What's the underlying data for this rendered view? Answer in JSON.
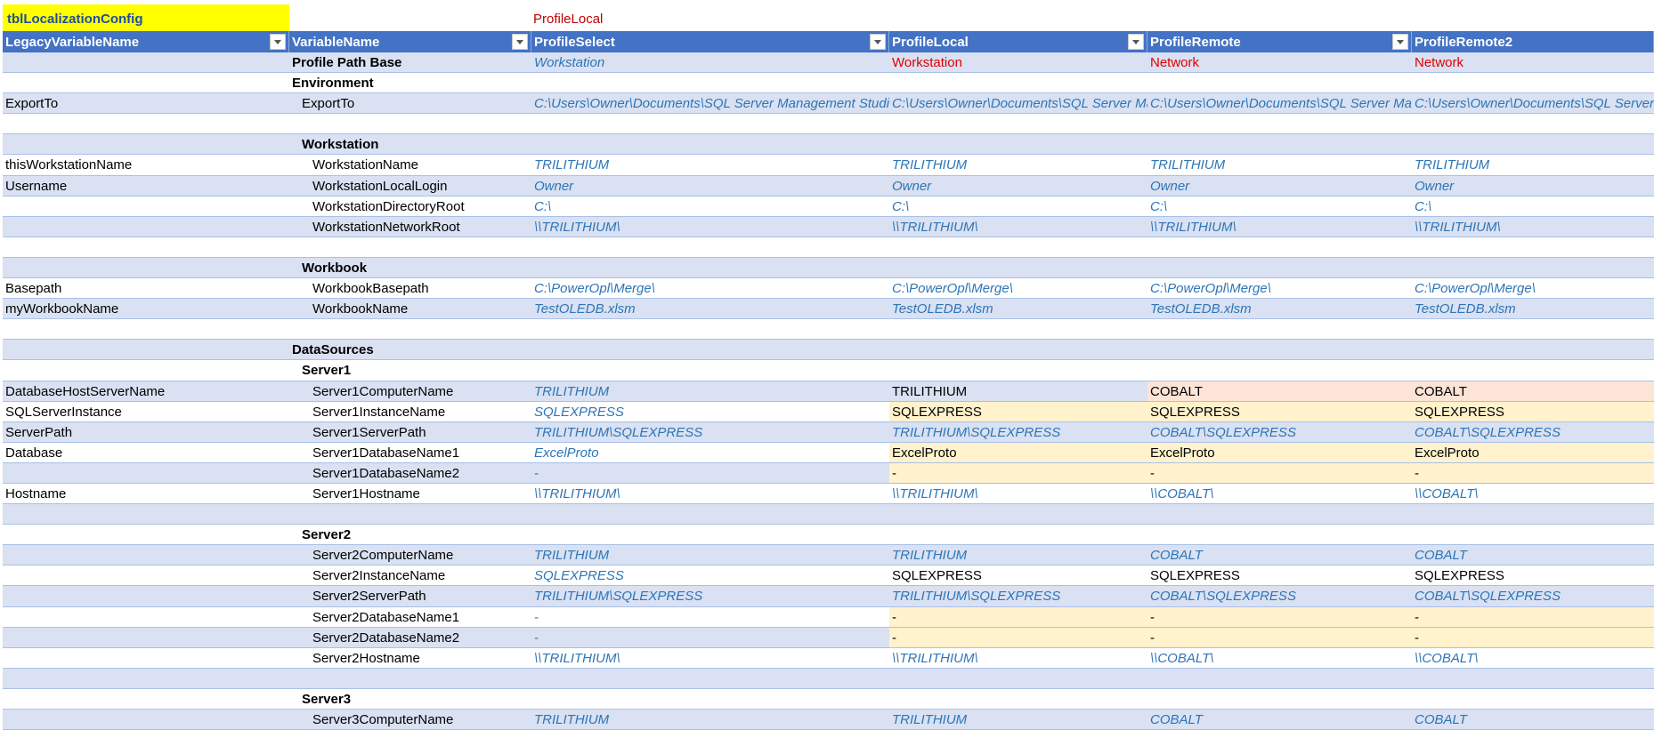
{
  "table_name": "tblLocalizationConfig",
  "selected_profile": "ProfileLocal",
  "headers": [
    "LegacyVariableName",
    "VariableName",
    "ProfileSelect",
    "ProfileLocal",
    "ProfileRemote",
    "ProfileRemote2"
  ],
  "rows": [
    {
      "legacy": "",
      "name": "Profile Path Base",
      "kind": "section",
      "vals": [
        "Workstation",
        "Workstation",
        "Network",
        "Network"
      ],
      "fmt": [
        "blue",
        "red",
        "red",
        "red"
      ]
    },
    {
      "legacy": "",
      "name": "Environment",
      "kind": "section",
      "vals": [
        "",
        "",
        "",
        ""
      ]
    },
    {
      "legacy": "ExportTo",
      "name": "ExportTo",
      "kind": "item1",
      "vals": [
        "C:\\Users\\Owner\\Documents\\SQL Server Management Studio\\",
        "C:\\Users\\Owner\\Documents\\SQL Server Management Studio\\",
        "C:\\Users\\Owner\\Documents\\SQL Server Management Studio\\",
        "C:\\Users\\Owner\\Documents\\SQL Server Management Studio\\"
      ],
      "fmt": [
        "blue",
        "blue",
        "blue",
        "blue"
      ]
    },
    {
      "legacy": "",
      "name": "",
      "kind": "blank",
      "vals": [
        "",
        "",
        "",
        ""
      ]
    },
    {
      "legacy": "",
      "name": "Workstation",
      "kind": "group",
      "vals": [
        "",
        "",
        "",
        ""
      ]
    },
    {
      "legacy": "thisWorkstationName",
      "name": "WorkstationName",
      "kind": "item",
      "vals": [
        "TRILITHIUM",
        "TRILITHIUM",
        "TRILITHIUM",
        "TRILITHIUM"
      ],
      "fmt": [
        "blue",
        "blue",
        "blue",
        "blue"
      ]
    },
    {
      "legacy": "Username",
      "name": "WorkstationLocalLogin",
      "kind": "item",
      "vals": [
        "Owner",
        "Owner",
        "Owner",
        "Owner"
      ],
      "fmt": [
        "blue",
        "blue",
        "blue",
        "blue"
      ]
    },
    {
      "legacy": "",
      "name": "WorkstationDirectoryRoot",
      "kind": "item",
      "vals": [
        "C:\\",
        "C:\\",
        "C:\\",
        "C:\\"
      ],
      "fmt": [
        "blue",
        "blue",
        "blue",
        "blue"
      ]
    },
    {
      "legacy": "",
      "name": "WorkstationNetworkRoot",
      "kind": "item",
      "vals": [
        "\\\\TRILITHIUM\\",
        "\\\\TRILITHIUM\\",
        "\\\\TRILITHIUM\\",
        "\\\\TRILITHIUM\\"
      ],
      "fmt": [
        "blue",
        "blue",
        "blue",
        "blue"
      ]
    },
    {
      "legacy": "",
      "name": "",
      "kind": "blank",
      "vals": [
        "",
        "",
        "",
        ""
      ]
    },
    {
      "legacy": "",
      "name": "Workbook",
      "kind": "group",
      "vals": [
        "",
        "",
        "",
        ""
      ]
    },
    {
      "legacy": "Basepath",
      "name": "WorkbookBasepath",
      "kind": "item",
      "vals": [
        "C:\\PowerOpl\\Merge\\",
        "C:\\PowerOpl\\Merge\\",
        "C:\\PowerOpl\\Merge\\",
        "C:\\PowerOpl\\Merge\\"
      ],
      "fmt": [
        "blue",
        "blue",
        "blue",
        "blue"
      ]
    },
    {
      "legacy": "myWorkbookName",
      "name": "WorkbookName",
      "kind": "item",
      "vals": [
        "TestOLEDB.xlsm",
        "TestOLEDB.xlsm",
        "TestOLEDB.xlsm",
        "TestOLEDB.xlsm"
      ],
      "fmt": [
        "blue",
        "blue",
        "blue",
        "blue"
      ]
    },
    {
      "legacy": "",
      "name": "",
      "kind": "blank",
      "vals": [
        "",
        "",
        "",
        ""
      ]
    },
    {
      "legacy": "",
      "name": "DataSources",
      "kind": "section",
      "vals": [
        "",
        "",
        "",
        ""
      ]
    },
    {
      "legacy": "",
      "name": "Server1",
      "kind": "group",
      "vals": [
        "",
        "",
        "",
        ""
      ]
    },
    {
      "legacy": "DatabaseHostServerName",
      "name": "Server1ComputerName",
      "kind": "item",
      "vals": [
        "TRILITHIUM",
        "TRILITHIUM",
        "COBALT",
        "COBALT"
      ],
      "fmt": [
        "blue",
        "plain",
        "plain fill-o",
        "plain fill-o"
      ]
    },
    {
      "legacy": "SQLServerInstance",
      "name": "Server1InstanceName",
      "kind": "item",
      "vals": [
        "SQLEXPRESS",
        "SQLEXPRESS",
        "SQLEXPRESS",
        "SQLEXPRESS"
      ],
      "fmt": [
        "blue",
        "plain fill-y",
        "plain fill-y",
        "plain fill-y"
      ]
    },
    {
      "legacy": "ServerPath",
      "name": "Server1ServerPath",
      "kind": "item",
      "vals": [
        "TRILITHIUM\\SQLEXPRESS",
        "TRILITHIUM\\SQLEXPRESS",
        "COBALT\\SQLEXPRESS",
        "COBALT\\SQLEXPRESS"
      ],
      "fmt": [
        "blue",
        "blue",
        "blue",
        "blue"
      ]
    },
    {
      "legacy": "Database",
      "name": "Server1DatabaseName1",
      "kind": "item",
      "vals": [
        "ExcelProto",
        "ExcelProto",
        "ExcelProto",
        "ExcelProto"
      ],
      "fmt": [
        "blue",
        "plain fill-y",
        "plain fill-y",
        "plain fill-y"
      ]
    },
    {
      "legacy": "",
      "name": "Server1DatabaseName2",
      "kind": "item",
      "vals": [
        "-",
        "-",
        "-",
        "-"
      ],
      "fmt": [
        "blue",
        "plain fill-y",
        "plain fill-y",
        "plain fill-y"
      ]
    },
    {
      "legacy": "Hostname",
      "name": "Server1Hostname",
      "kind": "item",
      "vals": [
        "\\\\TRILITHIUM\\",
        "\\\\TRILITHIUM\\",
        "\\\\COBALT\\",
        "\\\\COBALT\\"
      ],
      "fmt": [
        "blue",
        "blue",
        "blue",
        "blue"
      ]
    },
    {
      "legacy": "",
      "name": "",
      "kind": "blank",
      "vals": [
        "",
        "",
        "",
        ""
      ]
    },
    {
      "legacy": "",
      "name": "Server2",
      "kind": "group",
      "vals": [
        "",
        "",
        "",
        ""
      ]
    },
    {
      "legacy": "",
      "name": "Server2ComputerName",
      "kind": "item",
      "vals": [
        "TRILITHIUM",
        "TRILITHIUM",
        "COBALT",
        "COBALT"
      ],
      "fmt": [
        "blue",
        "blue",
        "blue",
        "blue"
      ]
    },
    {
      "legacy": "",
      "name": "Server2InstanceName",
      "kind": "item",
      "vals": [
        "SQLEXPRESS",
        "SQLEXPRESS",
        "SQLEXPRESS",
        "SQLEXPRESS"
      ],
      "fmt": [
        "blue",
        "plain",
        "plain",
        "plain"
      ]
    },
    {
      "legacy": "",
      "name": "Server2ServerPath",
      "kind": "item",
      "vals": [
        "TRILITHIUM\\SQLEXPRESS",
        "TRILITHIUM\\SQLEXPRESS",
        "COBALT\\SQLEXPRESS",
        "COBALT\\SQLEXPRESS"
      ],
      "fmt": [
        "blue",
        "blue",
        "blue",
        "blue"
      ]
    },
    {
      "legacy": "",
      "name": "Server2DatabaseName1",
      "kind": "item",
      "vals": [
        "-",
        "-",
        "-",
        "-"
      ],
      "fmt": [
        "blue",
        "plain fill-y",
        "plain fill-y",
        "plain fill-y"
      ]
    },
    {
      "legacy": "",
      "name": "Server2DatabaseName2",
      "kind": "item",
      "vals": [
        "-",
        "-",
        "-",
        "-"
      ],
      "fmt": [
        "blue",
        "plain fill-y",
        "plain fill-y",
        "plain fill-y"
      ]
    },
    {
      "legacy": "",
      "name": "Server2Hostname",
      "kind": "item",
      "vals": [
        "\\\\TRILITHIUM\\",
        "\\\\TRILITHIUM\\",
        "\\\\COBALT\\",
        "\\\\COBALT\\"
      ],
      "fmt": [
        "blue",
        "blue",
        "blue",
        "blue"
      ]
    },
    {
      "legacy": "",
      "name": "",
      "kind": "blank",
      "vals": [
        "",
        "",
        "",
        ""
      ]
    },
    {
      "legacy": "",
      "name": "Server3",
      "kind": "group",
      "vals": [
        "",
        "",
        "",
        ""
      ]
    },
    {
      "legacy": "",
      "name": "Server3ComputerName",
      "kind": "item",
      "vals": [
        "TRILITHIUM",
        "TRILITHIUM",
        "COBALT",
        "COBALT"
      ],
      "fmt": [
        "blue",
        "blue",
        "blue",
        "blue"
      ]
    }
  ],
  "colors": {
    "header_bg": "#4472c4",
    "band": "#d9e1f2",
    "title_bg": "#ffff00",
    "value_blue": "#2e75b6",
    "value_red": "#e00000",
    "fill_yellow": "#fff2cc",
    "fill_orange": "#fce4d6"
  }
}
